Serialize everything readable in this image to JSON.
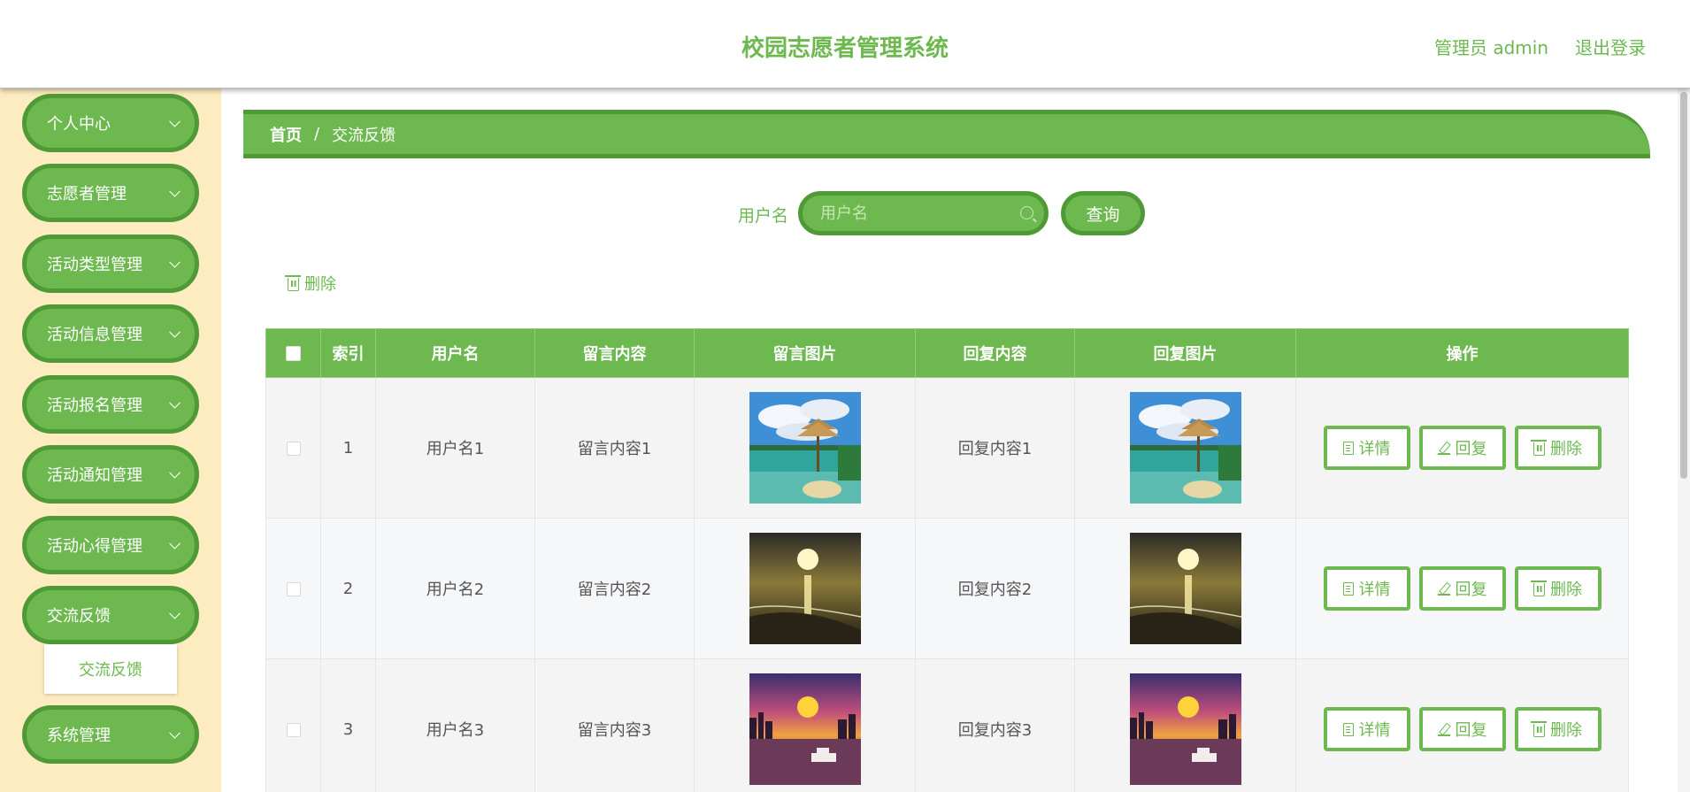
{
  "header": {
    "title": "校园志愿者管理系统",
    "user_label": "管理员 admin",
    "logout_label": "退出登录"
  },
  "sidebar": {
    "items": [
      {
        "label": "个人中心"
      },
      {
        "label": "志愿者管理"
      },
      {
        "label": "活动类型管理"
      },
      {
        "label": "活动信息管理"
      },
      {
        "label": "活动报名管理"
      },
      {
        "label": "活动通知管理"
      },
      {
        "label": "活动心得管理"
      },
      {
        "label": "交流反馈"
      },
      {
        "label": "系统管理"
      }
    ],
    "submenu_label": "交流反馈"
  },
  "breadcrumb": {
    "home": "首页",
    "separator": "/",
    "current": "交流反馈"
  },
  "search": {
    "label": "用户名",
    "placeholder": "用户名",
    "button_label": "查询"
  },
  "bulk_delete_label": "删除",
  "table": {
    "headers": [
      "索引",
      "用户名",
      "留言内容",
      "留言图片",
      "回复内容",
      "回复图片",
      "操作"
    ],
    "rows": [
      {
        "index": "1",
        "username": "用户名1",
        "message": "留言内容1",
        "reply": "回复内容1",
        "image": "beach-hut"
      },
      {
        "index": "2",
        "username": "用户名2",
        "message": "留言内容2",
        "reply": "回复内容2",
        "image": "sunset-sea"
      },
      {
        "index": "3",
        "username": "用户名3",
        "message": "留言内容3",
        "reply": "回复内容3",
        "image": "city-sunset"
      }
    ],
    "actions": {
      "detail": "详情",
      "reply": "回复",
      "delete": "删除"
    }
  },
  "colors": {
    "accent": "#6db950",
    "accent_dark": "#4f9a37",
    "sidebar_bg": "#fdecc0"
  }
}
